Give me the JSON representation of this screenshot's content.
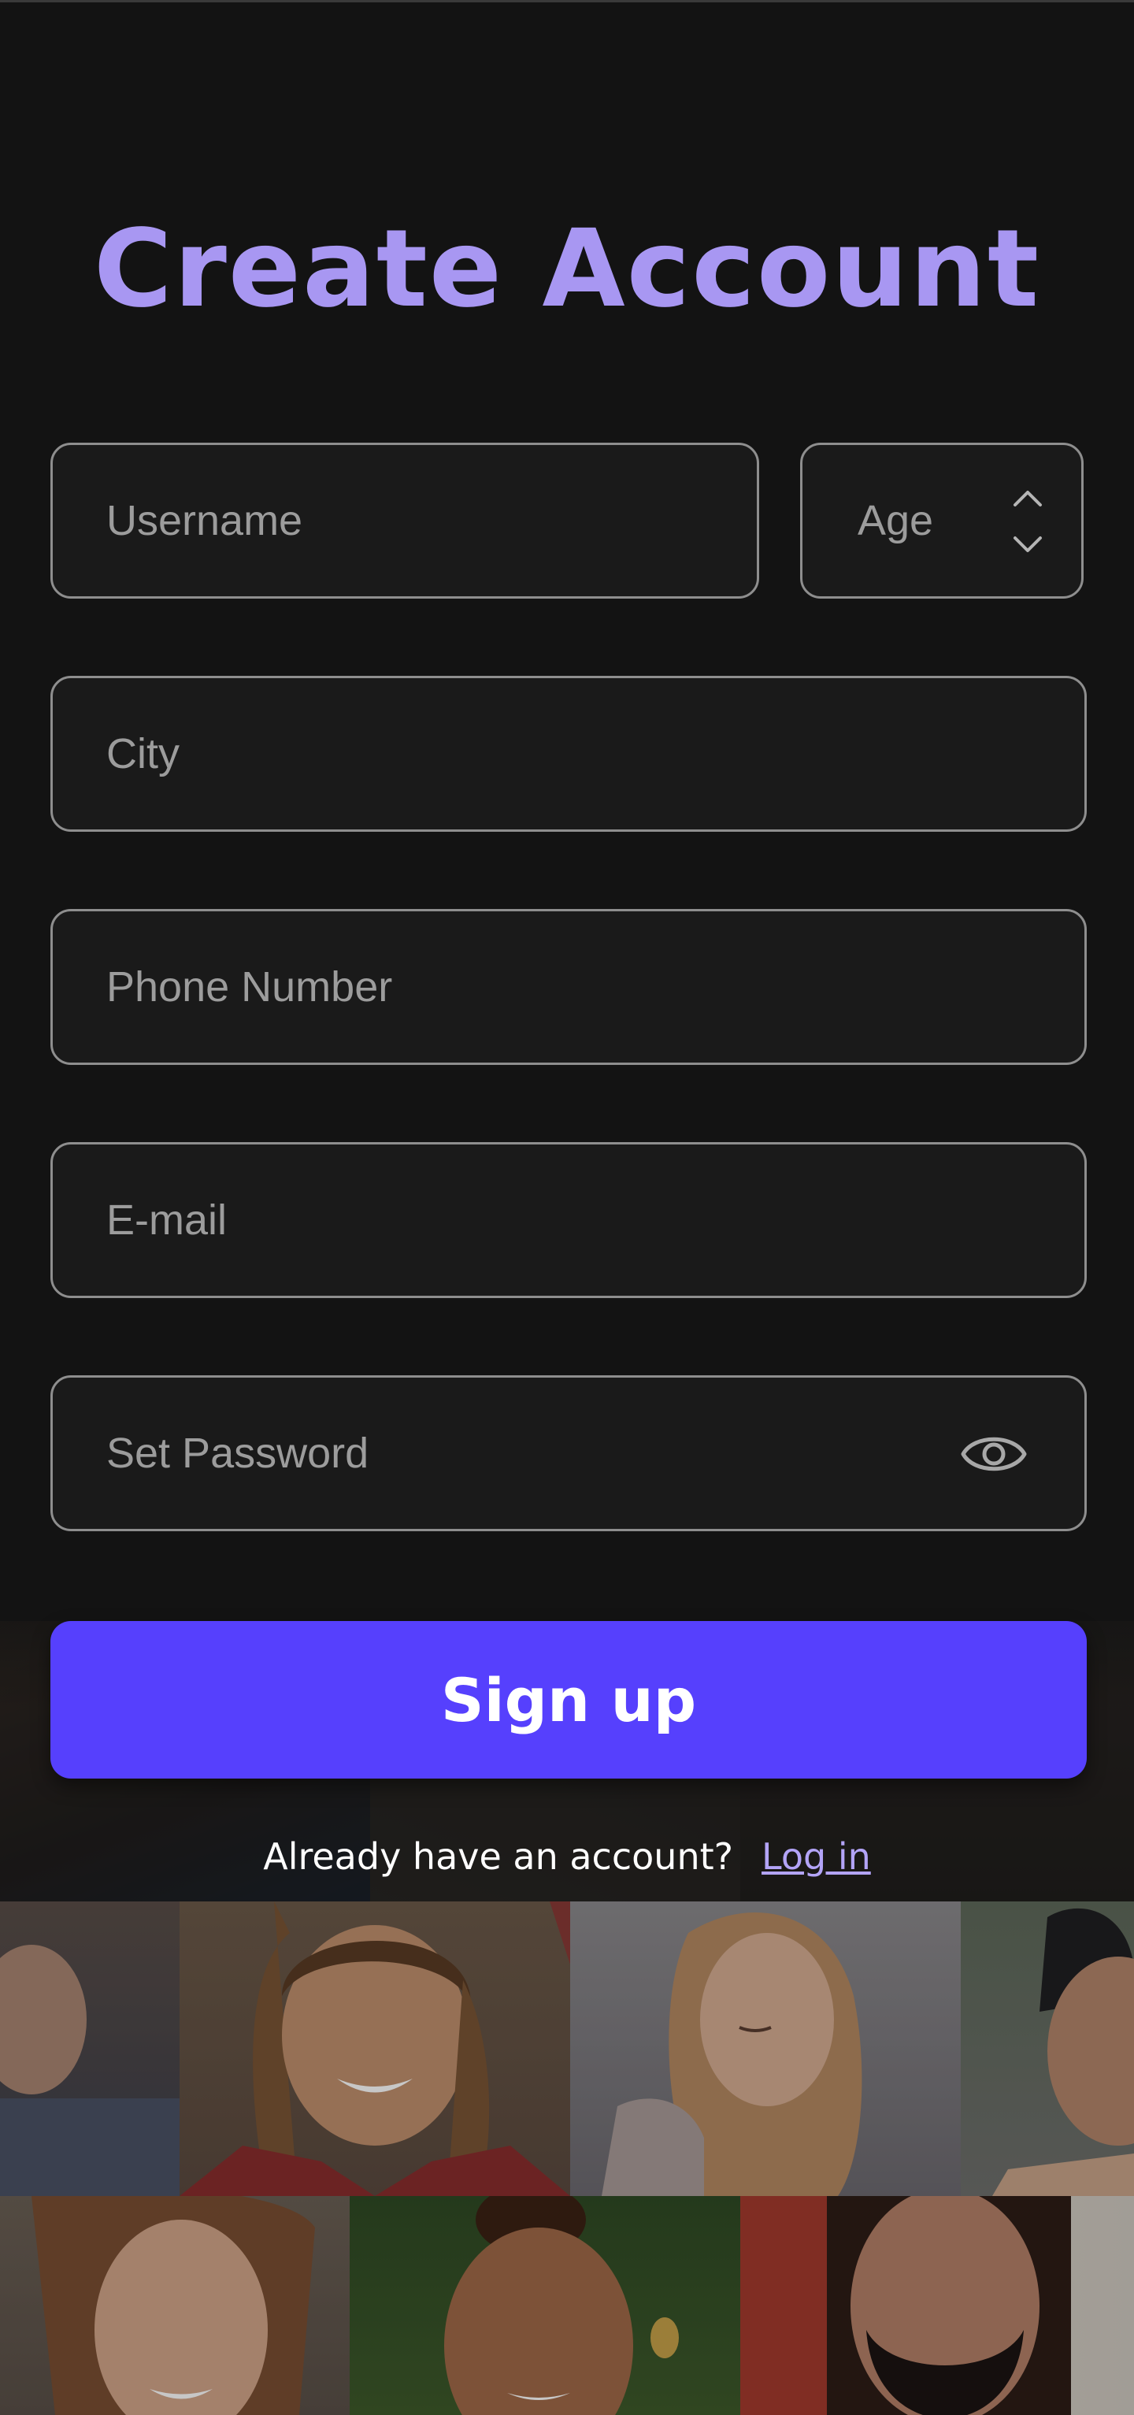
{
  "page": {
    "title": "Create Account"
  },
  "form": {
    "username_placeholder": "Username",
    "age_placeholder": "Age",
    "city_placeholder": "City",
    "phone_placeholder": "Phone Number",
    "email_placeholder": "E-mail",
    "password_placeholder": "Set Password"
  },
  "actions": {
    "signup_label": "Sign up",
    "login_prompt": "Already have an account?",
    "login_link": "Log in"
  },
  "icons": {
    "age_up": "chevron-up-icon",
    "age_down": "chevron-down-icon",
    "password_toggle": "eye-icon"
  },
  "colors": {
    "background": "#131313",
    "title": "#a897f2",
    "field_background": "#1a1a1a",
    "field_border": "#8e8e8e",
    "primary_button": "#5640fd",
    "link": "#b3a4f7"
  }
}
